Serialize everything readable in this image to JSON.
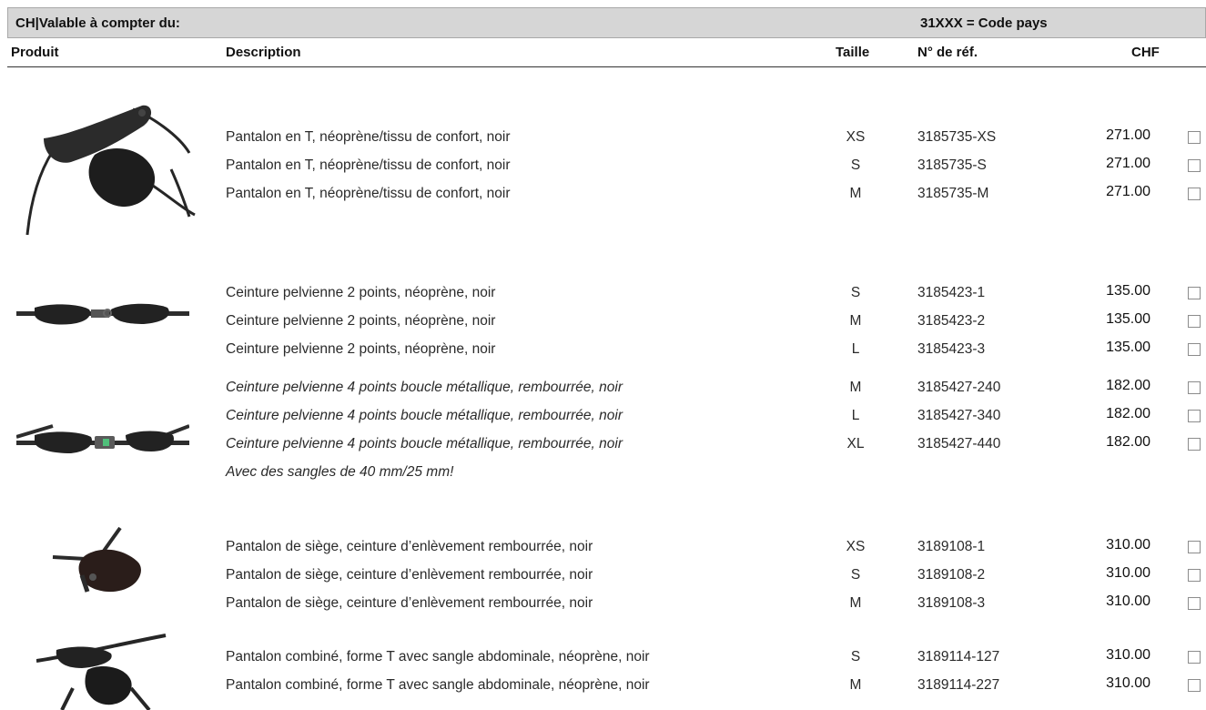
{
  "header": {
    "title": "CH|Valable à compter du:",
    "country_code_note": "31XXX = Code pays"
  },
  "columns": {
    "product": "Produit",
    "description": "Description",
    "size": "Taille",
    "ref": "N° de réf.",
    "price": "CHF"
  },
  "groups": [
    {
      "image": "t-shaped-pant-icon",
      "rows": [
        {
          "desc": "Pantalon en T, néoprène/tissu de confort, noir",
          "size": "XS",
          "ref": "3185735-XS",
          "price": "271.00"
        },
        {
          "desc": "Pantalon en T, néoprène/tissu de confort, noir",
          "size": "S",
          "ref": "3185735-S",
          "price": "271.00"
        },
        {
          "desc": "Pantalon en T, néoprène/tissu de confort, noir",
          "size": "M",
          "ref": "3185735-M",
          "price": "271.00"
        }
      ]
    },
    {
      "image": "pelvic-belt-2pt-icon",
      "rows": [
        {
          "desc": "Ceinture pelvienne 2 points, néoprène, noir",
          "size": "S",
          "ref": "3185423-1",
          "price": "135.00"
        },
        {
          "desc": "Ceinture pelvienne 2 points, néoprène, noir",
          "size": "M",
          "ref": "3185423-2",
          "price": "135.00"
        },
        {
          "desc": "Ceinture pelvienne 2 points, néoprène, noir",
          "size": "L",
          "ref": "3185423-3",
          "price": "135.00"
        }
      ]
    },
    {
      "image": "pelvic-belt-4pt-icon",
      "italic": true,
      "rows": [
        {
          "desc": "Ceinture pelvienne 4 points boucle métallique, rembourrée, noir",
          "size": "M",
          "ref": "3185427-240",
          "price": "182.00"
        },
        {
          "desc": "Ceinture pelvienne 4 points boucle métallique, rembourrée, noir",
          "size": "L",
          "ref": "3185427-340",
          "price": "182.00"
        },
        {
          "desc": "Ceinture pelvienne 4 points boucle métallique, rembourrée, noir",
          "size": "XL",
          "ref": "3185427-440",
          "price": "182.00"
        }
      ],
      "note": "Avec des sangles de 40 mm/25 mm!"
    },
    {
      "image": "seat-pant-icon",
      "rows": [
        {
          "desc": "Pantalon de siège, ceinture d’enlèvement rembourrée, noir",
          "size": "XS",
          "ref": "3189108-1",
          "price": "310.00"
        },
        {
          "desc": "Pantalon de siège, ceinture d’enlèvement rembourrée, noir",
          "size": "S",
          "ref": "3189108-2",
          "price": "310.00"
        },
        {
          "desc": "Pantalon de siège, ceinture d’enlèvement rembourrée, noir",
          "size": "M",
          "ref": "3189108-3",
          "price": "310.00"
        }
      ]
    },
    {
      "image": "combined-pant-icon",
      "rows": [
        {
          "desc": "Pantalon combiné, forme T avec sangle abdominale, néoprène, noir",
          "size": "S",
          "ref": "3189114-127",
          "price": "310.00"
        },
        {
          "desc": "Pantalon combiné, forme T avec sangle abdominale, néoprène, noir",
          "size": "M",
          "ref": "3189114-227",
          "price": "310.00"
        }
      ]
    }
  ]
}
